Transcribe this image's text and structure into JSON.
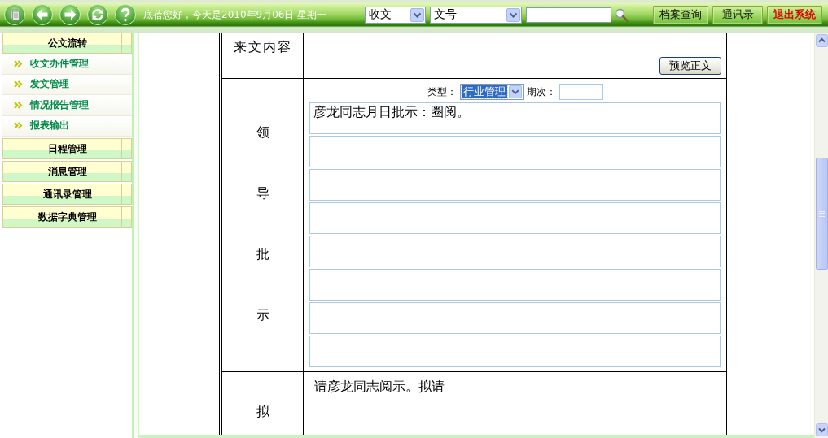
{
  "header": {
    "greeting": "底蓓您好，今天是2010年9月06日 星期一",
    "category_select": {
      "value": "收文"
    },
    "field_select": {
      "value": "文号"
    },
    "buttons": [
      {
        "label": "档案查询",
        "kind": "normal"
      },
      {
        "label": "通讯录",
        "kind": "normal"
      },
      {
        "label": "退出系统",
        "kind": "exit"
      }
    ]
  },
  "sidebar": {
    "sections": [
      {
        "title": "公文流转",
        "items": [
          "收文办件管理",
          "发文管理",
          "情况报告管理",
          "报表输出"
        ]
      },
      {
        "title": "日程管理"
      },
      {
        "title": "消息管理"
      },
      {
        "title": "通讯录管理"
      },
      {
        "title": "数据字典管理"
      }
    ]
  },
  "form": {
    "rows": [
      {
        "kind": "content",
        "label": "来文内容",
        "button": "预览正文"
      },
      {
        "kind": "instructions",
        "label": "领导批示",
        "type_label": "类型：",
        "type_select": {
          "value": "行业管理",
          "focused": true
        },
        "period_label": "期次：",
        "entries": [
          {
            "kind": "filled",
            "value": "彦龙同志月日批示：圈阅。"
          },
          {
            "kind": "blank"
          },
          {
            "kind": "blank"
          },
          {
            "kind": "blank"
          },
          {
            "kind": "blank"
          },
          {
            "kind": "blank"
          },
          {
            "kind": "blank"
          },
          {
            "kind": "blank"
          }
        ]
      },
      {
        "kind": "draft",
        "label": "拟",
        "text": "请彦龙同志阅示。拟请"
      }
    ]
  }
}
